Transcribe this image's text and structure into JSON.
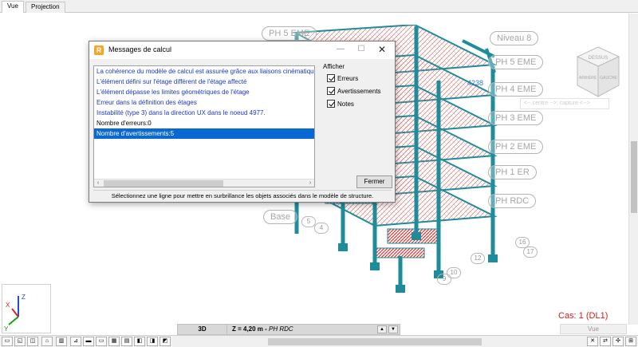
{
  "tabs": [
    {
      "label": "Vue",
      "active": true
    },
    {
      "label": "Projection",
      "active": false
    }
  ],
  "levels": [
    "PH 5 EME",
    "Niveau 8",
    "PH 5 EME",
    "PH 4 EME",
    "PH 3 EME",
    "PH 2 EME",
    "PH 1 ER",
    "PH RDC",
    "Base"
  ],
  "nodes": [
    "5",
    "4",
    "12",
    "17",
    "10",
    "9",
    "16"
  ],
  "blue_label": "4238",
  "ghost_field": "<-- centre -->; capture <-->",
  "cube_labels": {
    "top": "DESSUS",
    "left": "ARRIÈRE",
    "right": "GAUCHE"
  },
  "axes": {
    "x": "X",
    "y": "Y",
    "z": "Z"
  },
  "cas_label": "Cas: 1 (DL1)",
  "statusbar": {
    "view_mode": "3D",
    "z_text": "Z = 4,20 m -",
    "z_level": "PH RDC"
  },
  "vue_button": "Vue",
  "dialog": {
    "title": "Messages de calcul",
    "messages": [
      {
        "text": "La cohérence du modèle de calcul est assurée grâce aux liaisons cinématiques",
        "color": "blue"
      },
      {
        "text": "L'élément défini sur l'étage différent de l'étage affecté",
        "color": "blue"
      },
      {
        "text": "L'élément dépasse les limites géométriques de l'étage",
        "color": "blue"
      },
      {
        "text": "Erreur dans la définition des étages",
        "color": "blue"
      },
      {
        "text": "Instabilité (type 3) dans la direction UX dans le noeud 4977.",
        "color": "blue"
      },
      {
        "text": "Nombre d'erreurs:0",
        "color": "black"
      },
      {
        "text": "Nombre d'avertissements:5",
        "color": "selected"
      }
    ],
    "afficher_title": "Afficher",
    "checkboxes": [
      {
        "label": "Erreurs",
        "checked": true
      },
      {
        "label": "Avertissements",
        "checked": true
      },
      {
        "label": "Notes",
        "checked": true
      }
    ],
    "close_button": "Fermer",
    "hint": "Sélectionnez une ligne pour mettre en surbrillance les objets associés dans le modèle de structure."
  },
  "colors": {
    "selection": "#0a68d2",
    "message_blue": "#1b38c8",
    "structure": "#1e8c9b",
    "load_red": "#e02020",
    "cas_red": "#d81b1b"
  }
}
